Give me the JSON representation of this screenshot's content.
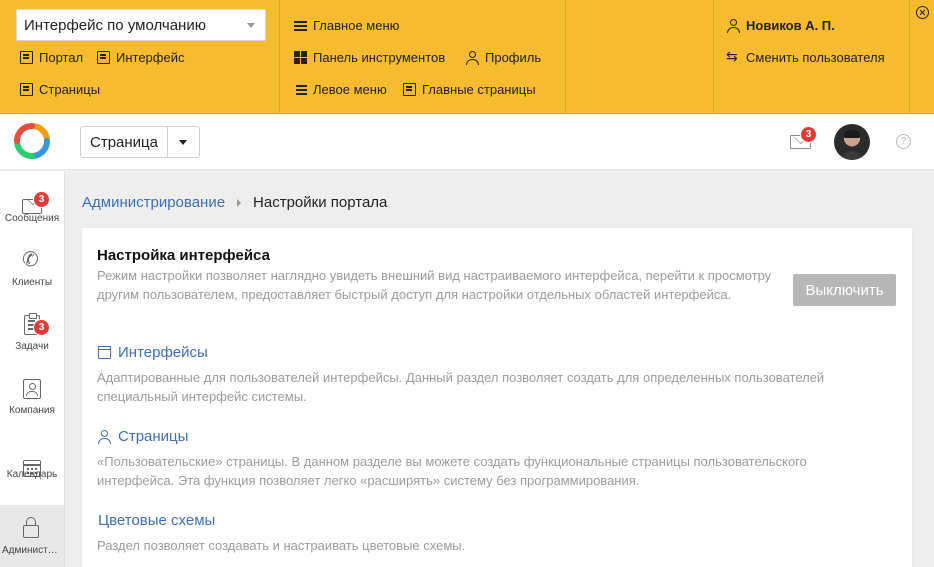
{
  "admin_panel": {
    "interface_select": {
      "value": "Интерфейс по умолчанию"
    },
    "links_col1": [
      {
        "label": "Портал",
        "icon": "document-icon"
      },
      {
        "label": "Интерфейс",
        "icon": "document-icon"
      },
      {
        "label": "Страницы",
        "icon": "document-icon"
      }
    ],
    "links_col2": [
      {
        "label": "Главное меню",
        "icon": "menu-icon"
      },
      {
        "label": "Панель инструментов",
        "icon": "grid-icon"
      },
      {
        "label": "Профиль",
        "icon": "user-icon"
      },
      {
        "label": "Левое меню",
        "icon": "list-icon"
      },
      {
        "label": "Главные страницы",
        "icon": "document-icon"
      }
    ],
    "user_name": "Новиков А. П.",
    "switch_user": "Сменить пользователя",
    "accent_color": "#f6bb2f"
  },
  "header": {
    "page_select": {
      "value": "Страница"
    },
    "mail_badge": "3"
  },
  "sidebar": {
    "items": [
      {
        "label": "Сообщения",
        "icon": "mail-icon",
        "badge": "3"
      },
      {
        "label": "Клиенты",
        "icon": "phone-icon"
      },
      {
        "label": "Задачи",
        "icon": "clipboard-icon",
        "badge": "3"
      },
      {
        "label": "Компания",
        "icon": "contact-card-icon"
      },
      {
        "label": "Календарь",
        "icon": "calendar-icon"
      },
      {
        "label": "Администрирование",
        "icon": "lock-icon",
        "active": true
      }
    ]
  },
  "breadcrumb": {
    "parent": "Администрирование",
    "current": "Настройки портала"
  },
  "main": {
    "title": "Настройка интерфейса",
    "description": "Режим настройки позволяет наглядно увидеть внешний вид настраиваемого интерфейса, перейти к просмотру другим пользователем, предоставляет быстрый доступ для настройки отдельных областей интерфейса.",
    "off_button": "Выключить",
    "sections": [
      {
        "title": "Интерфейсы",
        "icon": "window-icon",
        "description": "Адаптированные для пользователей интерфейсы. Данный раздел позволяет создать для определенных пользователей специальный интерфейс системы."
      },
      {
        "title": "Страницы",
        "icon": "person-icon",
        "description": "«Пользовательские» страницы. В данном разделе вы можете создать функциональные страницы пользовательского интерфейса. Эта функция позволяет легко «расширять» систему без программирования."
      },
      {
        "title": "Цветовые схемы",
        "icon": "",
        "description": "Раздел позволяет создавать и настраивать цветовые схемы."
      }
    ]
  }
}
